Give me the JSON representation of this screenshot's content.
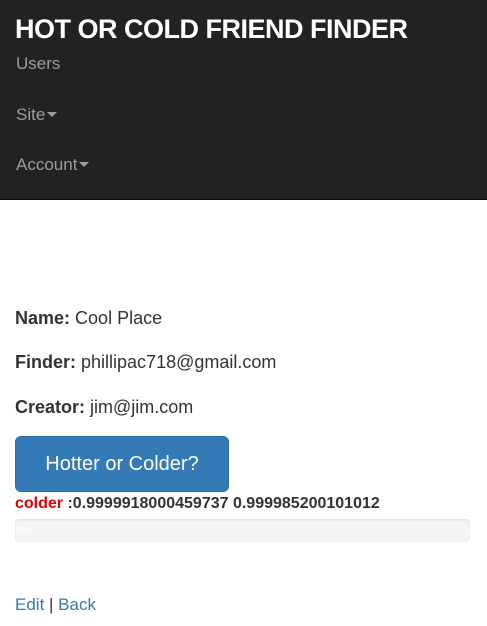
{
  "navbar": {
    "brand": "HOT OR COLD FRIEND FINDER",
    "items": [
      {
        "label": "Users"
      },
      {
        "label": "Site"
      },
      {
        "label": "Account"
      }
    ]
  },
  "details": {
    "name_label": "Name:",
    "name_value": "Cool Place",
    "finder_label": "Finder:",
    "finder_value": "phillipac718@gmail.com",
    "creator_label": "Creator:",
    "creator_value": "jim@jim.com"
  },
  "action_button": "Hotter or Colder?",
  "result": {
    "word": "colder",
    "values": " :0.9999918000459737 0.999985200101012"
  },
  "progress": {
    "label": "0%",
    "fraction": 0
  },
  "links": {
    "edit": "Edit",
    "separator": " | ",
    "back": "Back"
  },
  "colors": {
    "navbar_bg": "#222222",
    "primary": "#337ab7",
    "colder": "#e00000"
  }
}
